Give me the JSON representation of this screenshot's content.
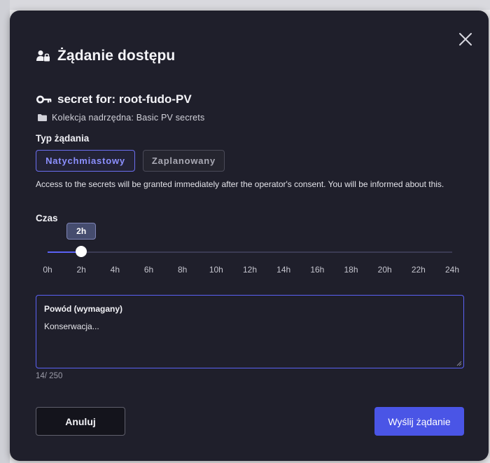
{
  "dialog": {
    "title": "Żądanie dostępu",
    "title_icon": "user-lock-icon",
    "close_icon": "close-icon"
  },
  "secret": {
    "icon": "key-icon",
    "name": "secret for: root-fudo-PV",
    "parent_icon": "folder-icon",
    "parent": "Kolekcja nadrzędna: Basic PV secrets"
  },
  "request_type": {
    "label": "Typ żądania",
    "options": [
      "Natychmiastowy",
      "Zaplanowany"
    ],
    "selected": "Natychmiastowy",
    "description": "Access to the secrets will be granted immediately after the operator's consent. You will be informed about this."
  },
  "duration": {
    "label": "Czas",
    "value_label": "2h",
    "value_hours": 2,
    "max_hours": 24,
    "ticks": [
      "0h",
      "2h",
      "4h",
      "6h",
      "8h",
      "10h",
      "12h",
      "14h",
      "16h",
      "18h",
      "20h",
      "22h",
      "24h"
    ]
  },
  "reason": {
    "label": "Powód (wymagany)",
    "value": "Konserwacja...",
    "counter": "14/ 250"
  },
  "actions": {
    "cancel": "Anuluj",
    "submit": "Wyślij żądanie"
  },
  "colors": {
    "modal_bg": "#1f1f2b",
    "accent": "#4a55e6",
    "accent_text": "#8c90ff"
  }
}
